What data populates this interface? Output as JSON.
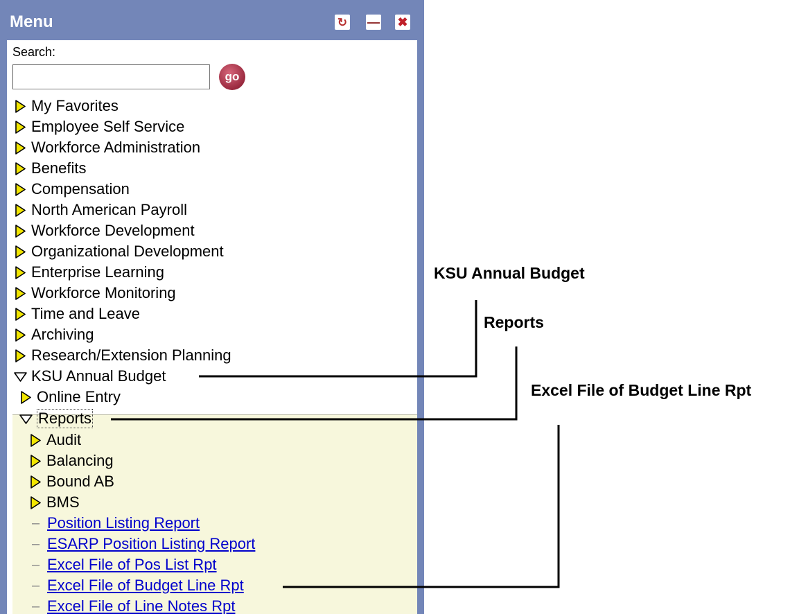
{
  "menu": {
    "title": "Menu",
    "buttons": {
      "refresh": "refresh-icon",
      "minimize": "minimize-icon",
      "close": "close-icon"
    }
  },
  "search": {
    "label": "Search:",
    "value": "",
    "go_label": "go"
  },
  "nav_items": [
    {
      "label": "My Favorites",
      "state": "collapsed"
    },
    {
      "label": "Employee Self Service",
      "state": "collapsed"
    },
    {
      "label": "Workforce Administration",
      "state": "collapsed"
    },
    {
      "label": "Benefits",
      "state": "collapsed"
    },
    {
      "label": "Compensation",
      "state": "collapsed"
    },
    {
      "label": "North American Payroll",
      "state": "collapsed"
    },
    {
      "label": "Workforce Development",
      "state": "collapsed"
    },
    {
      "label": "Organizational Development",
      "state": "collapsed"
    },
    {
      "label": "Enterprise Learning",
      "state": "collapsed"
    },
    {
      "label": "Workforce Monitoring",
      "state": "collapsed"
    },
    {
      "label": "Time and Leave",
      "state": "collapsed"
    },
    {
      "label": "Archiving",
      "state": "collapsed"
    },
    {
      "label": "Research/Extension Planning",
      "state": "collapsed"
    },
    {
      "label": "KSU Annual Budget",
      "state": "expanded"
    }
  ],
  "ksu_children": [
    {
      "label": "Online Entry",
      "state": "collapsed"
    },
    {
      "label": "Reports",
      "state": "expanded"
    }
  ],
  "report_children": [
    {
      "label": "Audit",
      "state": "collapsed"
    },
    {
      "label": "Balancing",
      "state": "collapsed"
    },
    {
      "label": "Bound AB",
      "state": "collapsed"
    },
    {
      "label": "BMS",
      "state": "collapsed"
    }
  ],
  "report_links": [
    {
      "label": "Position Listing Report"
    },
    {
      "label": "ESARP Position Listing Report"
    },
    {
      "label": "Excel File of Pos List Rpt"
    },
    {
      "label": "Excel File of Budget Line Rpt"
    },
    {
      "label": "Excel File of Line Notes Rpt"
    }
  ],
  "annotations": {
    "ksu": "KSU Annual Budget",
    "reports": "Reports",
    "excel": "Excel File of Budget Line Rpt"
  },
  "colors": {
    "panel_blue": "#7386b8",
    "highlight_bg": "#f7f7dc",
    "link_blue": "#0000cc",
    "triangle_fill": "#f2e600"
  }
}
